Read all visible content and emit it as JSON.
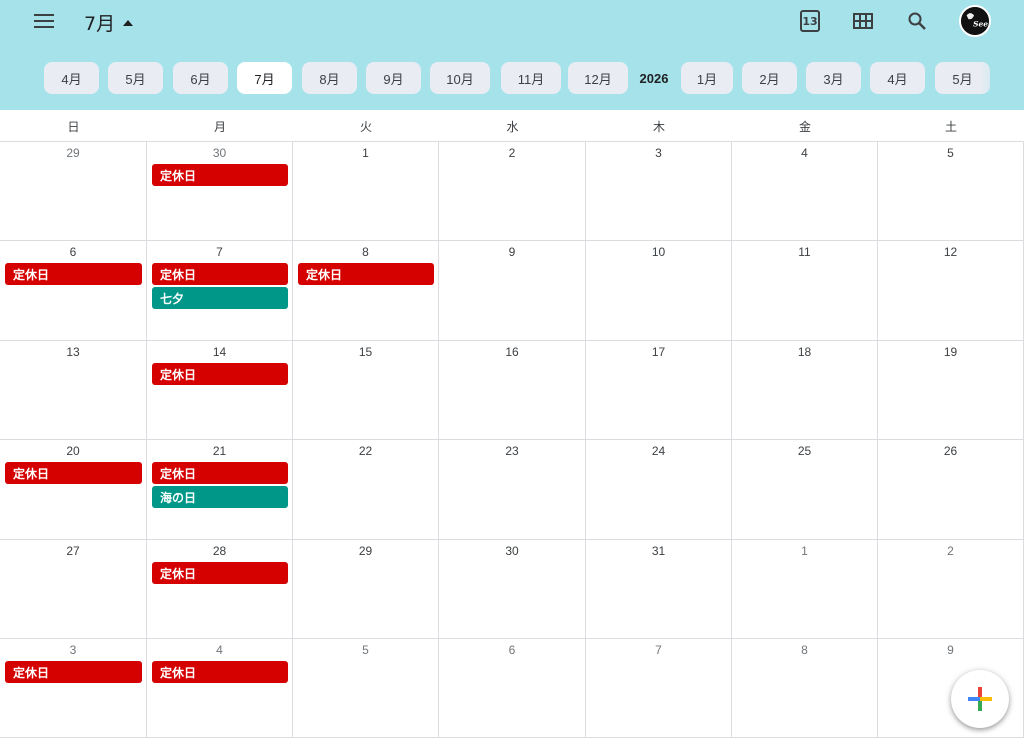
{
  "header": {
    "menu_icon": "hamburger-menu-icon",
    "title": "7月",
    "title_caret_icon": "caret-up-icon",
    "today_icon_label": "13",
    "grid_icon": "month-grid-icon",
    "search_icon": "search-icon",
    "avatar_text": "See"
  },
  "month_strip": {
    "months_before": [
      {
        "label": "4月",
        "active": false
      },
      {
        "label": "5月",
        "active": false
      },
      {
        "label": "6月",
        "active": false
      },
      {
        "label": "7月",
        "active": true
      },
      {
        "label": "8月",
        "active": false
      },
      {
        "label": "9月",
        "active": false
      },
      {
        "label": "10月",
        "active": false
      },
      {
        "label": "11月",
        "active": false
      },
      {
        "label": "12月",
        "active": false
      }
    ],
    "year_label": "2026",
    "months_after": [
      {
        "label": "1月",
        "active": false
      },
      {
        "label": "2月",
        "active": false
      },
      {
        "label": "3月",
        "active": false
      },
      {
        "label": "4月",
        "active": false
      },
      {
        "label": "5月",
        "active": false
      }
    ]
  },
  "weekdays": [
    "日",
    "月",
    "火",
    "水",
    "木",
    "金",
    "土"
  ],
  "weeks": [
    [
      {
        "day": "29",
        "muted": true,
        "events": []
      },
      {
        "day": "30",
        "muted": true,
        "events": [
          {
            "title": "定休日",
            "color": "#d50000"
          }
        ]
      },
      {
        "day": "1",
        "muted": false,
        "events": []
      },
      {
        "day": "2",
        "muted": false,
        "events": []
      },
      {
        "day": "3",
        "muted": false,
        "events": []
      },
      {
        "day": "4",
        "muted": false,
        "events": []
      },
      {
        "day": "5",
        "muted": false,
        "events": []
      }
    ],
    [
      {
        "day": "6",
        "muted": false,
        "events": [
          {
            "title": "定休日",
            "color": "#d50000"
          }
        ]
      },
      {
        "day": "7",
        "muted": false,
        "events": [
          {
            "title": "定休日",
            "color": "#d50000"
          },
          {
            "title": "七夕",
            "color": "#009688"
          }
        ]
      },
      {
        "day": "8",
        "muted": false,
        "events": [
          {
            "title": "定休日",
            "color": "#d50000"
          }
        ]
      },
      {
        "day": "9",
        "muted": false,
        "events": []
      },
      {
        "day": "10",
        "muted": false,
        "events": []
      },
      {
        "day": "11",
        "muted": false,
        "events": []
      },
      {
        "day": "12",
        "muted": false,
        "events": []
      }
    ],
    [
      {
        "day": "13",
        "muted": false,
        "events": []
      },
      {
        "day": "14",
        "muted": false,
        "events": [
          {
            "title": "定休日",
            "color": "#d50000"
          }
        ]
      },
      {
        "day": "15",
        "muted": false,
        "events": []
      },
      {
        "day": "16",
        "muted": false,
        "events": []
      },
      {
        "day": "17",
        "muted": false,
        "events": []
      },
      {
        "day": "18",
        "muted": false,
        "events": []
      },
      {
        "day": "19",
        "muted": false,
        "events": []
      }
    ],
    [
      {
        "day": "20",
        "muted": false,
        "events": [
          {
            "title": "定休日",
            "color": "#d50000"
          }
        ]
      },
      {
        "day": "21",
        "muted": false,
        "events": [
          {
            "title": "定休日",
            "color": "#d50000"
          },
          {
            "title": "海の日",
            "color": "#009688"
          }
        ]
      },
      {
        "day": "22",
        "muted": false,
        "events": []
      },
      {
        "day": "23",
        "muted": false,
        "events": []
      },
      {
        "day": "24",
        "muted": false,
        "events": []
      },
      {
        "day": "25",
        "muted": false,
        "events": []
      },
      {
        "day": "26",
        "muted": false,
        "events": []
      }
    ],
    [
      {
        "day": "27",
        "muted": false,
        "events": []
      },
      {
        "day": "28",
        "muted": false,
        "events": [
          {
            "title": "定休日",
            "color": "#d50000"
          }
        ]
      },
      {
        "day": "29",
        "muted": false,
        "events": []
      },
      {
        "day": "30",
        "muted": false,
        "events": []
      },
      {
        "day": "31",
        "muted": false,
        "events": []
      },
      {
        "day": "1",
        "muted": true,
        "events": []
      },
      {
        "day": "2",
        "muted": true,
        "events": []
      }
    ],
    [
      {
        "day": "3",
        "muted": true,
        "events": [
          {
            "title": "定休日",
            "color": "#d50000"
          }
        ]
      },
      {
        "day": "4",
        "muted": true,
        "events": [
          {
            "title": "定休日",
            "color": "#d50000"
          }
        ]
      },
      {
        "day": "5",
        "muted": true,
        "events": []
      },
      {
        "day": "6",
        "muted": true,
        "events": []
      },
      {
        "day": "7",
        "muted": true,
        "events": []
      },
      {
        "day": "8",
        "muted": true,
        "events": []
      },
      {
        "day": "9",
        "muted": true,
        "events": []
      }
    ]
  ],
  "fab": {
    "icon": "multicolor-plus-icon"
  },
  "colors": {
    "header_bg": "#a6e2ea",
    "holiday_closed": "#d50000",
    "holiday_national": "#009688"
  }
}
